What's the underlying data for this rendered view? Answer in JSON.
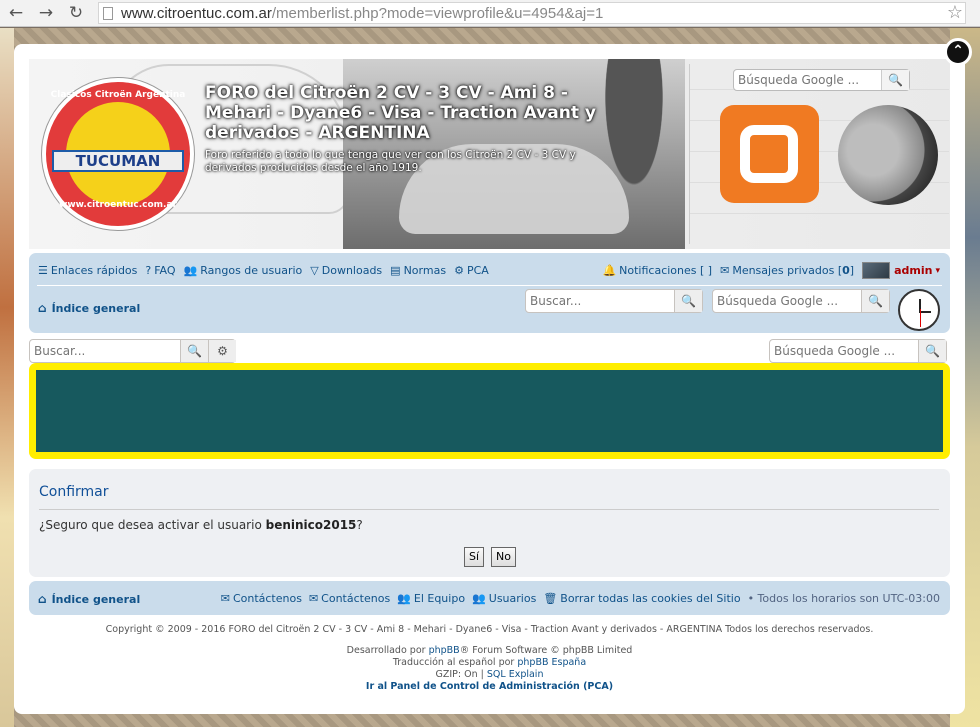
{
  "browser": {
    "url_host": "www.citroentuc.com.ar",
    "url_path": "/memberlist.php?mode=viewprofile&u=4954&aj=1",
    "back_icon": "arrow-left-icon",
    "forward_icon": "arrow-right-icon",
    "reload_icon": "reload-icon",
    "bookmark_icon": "star-icon"
  },
  "header": {
    "logo": {
      "top_text": "Clasicos Citroën Argentina",
      "band_text": "TUCUMAN",
      "bottom_text": "www.citroentuc.com.ar"
    },
    "site_title": "FORO del Citroën 2 CV - 3 CV - Ami 8 - Mehari - Dyane6 - Visa - Traction Avant y derivados - ARGENTINA",
    "site_description": "Foro referido a todo lo que tenga que ver con los Citroën 2 CV - 3 CV y derivados producidos desde el año 1919.",
    "google_search_placeholder": "Búsqueda Google ..."
  },
  "navbar": {
    "quick_links": "Enlaces rápidos",
    "faq": "FAQ",
    "ranks": "Rangos de usuario",
    "downloads": "Downloads",
    "rules": "Normas",
    "pca": "PCA",
    "notifications": "Notificaciones",
    "notifications_count": "[ ]",
    "private_messages": "Mensajes privados",
    "pm_count_open": "[",
    "pm_count": "0",
    "pm_count_close": "]",
    "username": "admin",
    "user_caret": "▾",
    "breadcrumb": "Índice general",
    "search_placeholder": "Buscar...",
    "google_search_placeholder": "Búsqueda Google ..."
  },
  "subbar": {
    "search_placeholder": "Buscar...",
    "google_search_placeholder": "Búsqueda Google ..."
  },
  "confirm": {
    "title": "Confirmar",
    "message_prefix": "¿Seguro que desea activar el usuario ",
    "username": "beninico2015",
    "message_suffix": "?",
    "yes_label": "Sí",
    "no_label": "No"
  },
  "footer_nav": {
    "breadcrumb": "Índice general",
    "contact1": "Contáctenos",
    "contact2": "Contáctenos",
    "team": "El Equipo",
    "members": "Usuarios",
    "delete_cookies": "Borrar todas las cookies del Sitio",
    "timezone": "• Todos los horarios son UTC-03:00"
  },
  "footer": {
    "copyright": "Copyright © 2009 - 2016 FORO del Citroën 2 CV - 3 CV - Ami 8 - Mehari - Dyane6 - Visa - Traction Avant y derivados - ARGENTINA Todos los derechos reservados.",
    "developed_prefix": "Desarrollado por ",
    "phpbb": "phpBB",
    "developed_suffix": "® Forum Software © phpBB Limited",
    "translation_prefix": "Traducción al español por ",
    "phpbb_es": "phpBB España",
    "gzip": "GZIP: On | ",
    "sql_explain": "SQL Explain",
    "acp_link": "Ir al Panel de Control de Administración (PCA)"
  },
  "colors": {
    "nav_bg": "#cadceb",
    "link": "#105289",
    "announce_border": "#ffee00",
    "announce_fill": "#17595e",
    "admin": "#aa0000"
  }
}
